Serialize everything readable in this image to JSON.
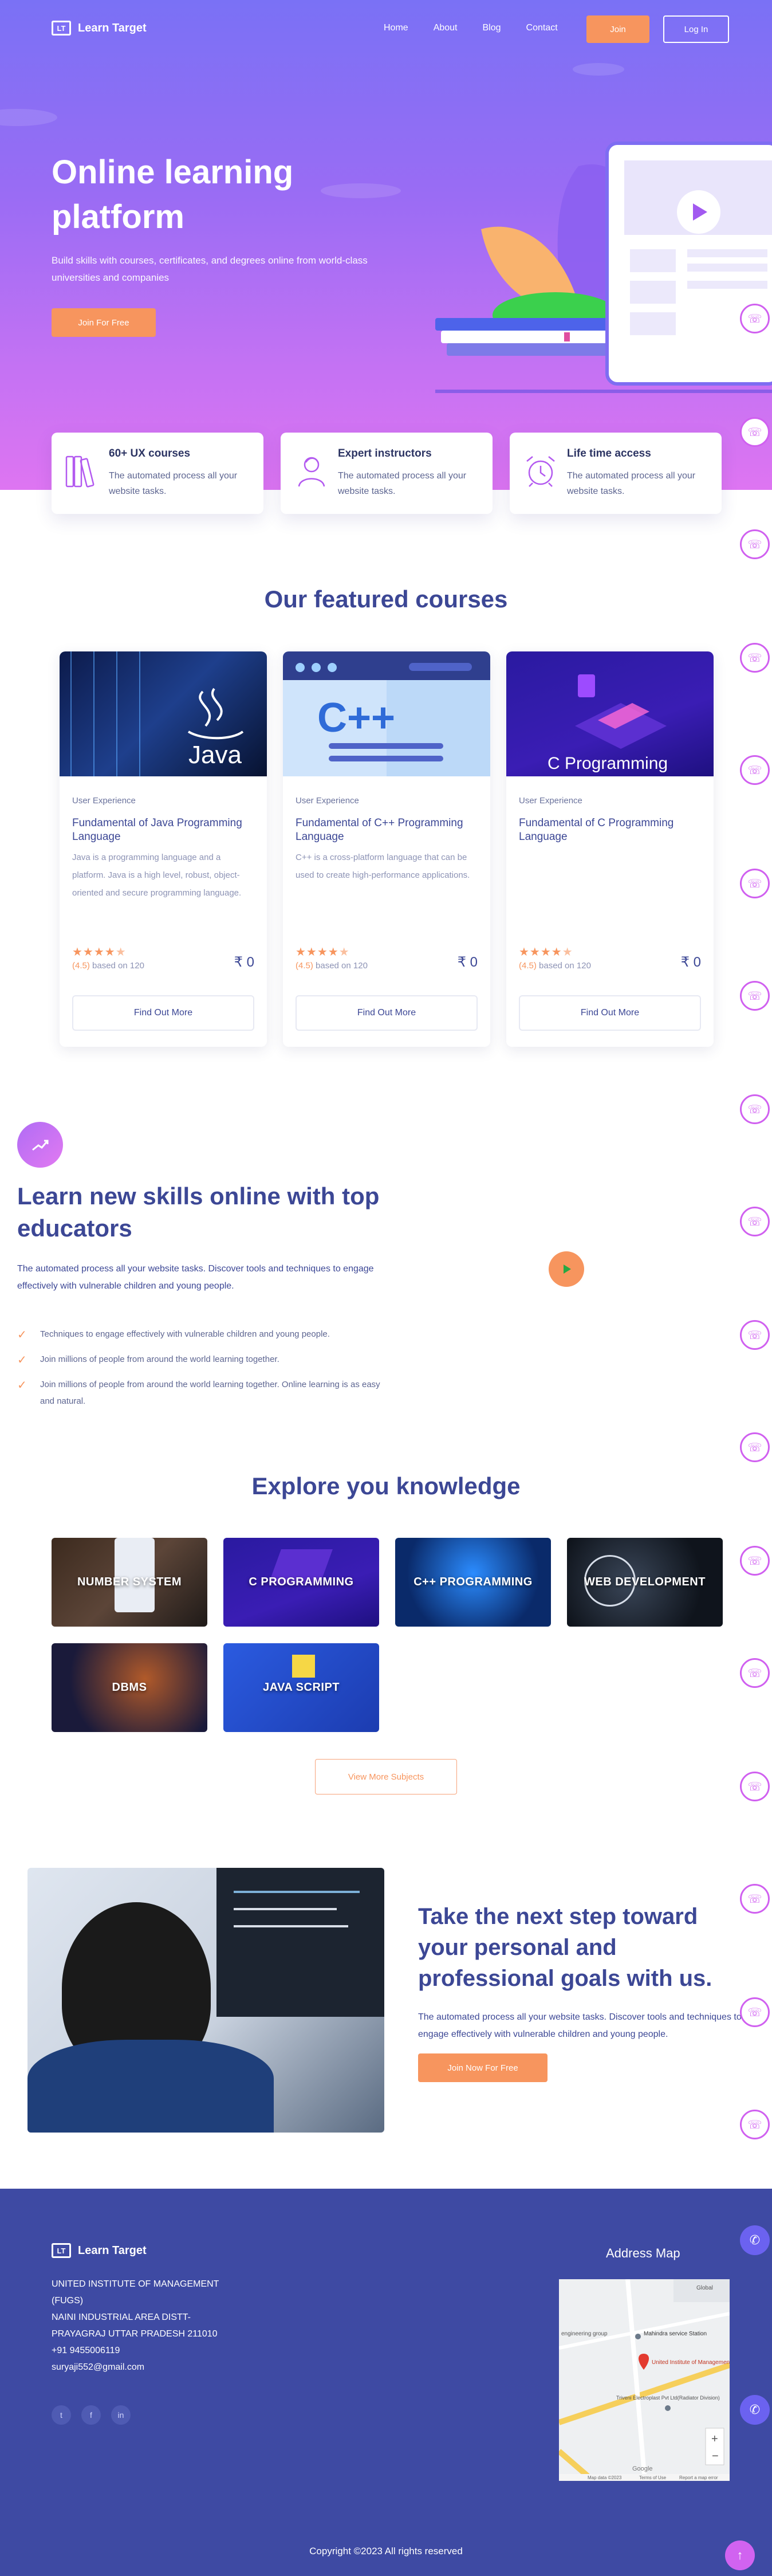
{
  "colors": {
    "accent": "#f7955e",
    "primary": "#3c4795",
    "footer": "#3e4aa3",
    "hero_start": "#7a71f5",
    "hero_end": "#de75f2"
  },
  "nav": {
    "logo_text": "Learn Target",
    "logo_mark": "LT",
    "links": [
      "Home",
      "About",
      "Blog",
      "Contact"
    ],
    "join_label": "Join",
    "login_label": "Log In"
  },
  "hero": {
    "title": "Online learning platform",
    "subtitle": "Build skills with courses, certificates, and degrees online from world-class universities and companies",
    "cta_label": "Join For Free"
  },
  "features": [
    {
      "icon": "books-icon",
      "title": "60+ UX courses",
      "desc": "The automated process all your website tasks."
    },
    {
      "icon": "instructor-icon",
      "title": "Expert instructors",
      "desc": "The automated process all your website tasks."
    },
    {
      "icon": "alarm-clock-icon",
      "title": "Life time access",
      "desc": "The automated process all your website tasks."
    }
  ],
  "featured": {
    "title": "Our featured courses",
    "courses": [
      {
        "image_label": "Java",
        "category": "User Experience",
        "name": "Fundamental of Java Programming Language",
        "desc": "Java is a programming language and a platform. Java is a high level, robust, object-oriented and secure programming language.",
        "rating": 4.5,
        "rating_value": "(4.5)",
        "based_on": "based on 120",
        "price": "₹ 0",
        "button": "Find Out More"
      },
      {
        "image_label": "C++",
        "category": "User Experience",
        "name": "Fundamental of C++ Programming Language",
        "desc": "C++ is a cross-platform language that can be used to create high-performance applications.",
        "rating": 4.5,
        "rating_value": "(4.5)",
        "based_on": "based on 120",
        "price": "₹ 0",
        "button": "Find Out More"
      },
      {
        "image_label": "C Programming",
        "category": "User Experience",
        "name": "Fundamental of C Programming Language",
        "desc": "",
        "rating": 4.5,
        "rating_value": "(4.5)",
        "based_on": "based on 120",
        "price": "₹ 0",
        "button": "Find Out More"
      }
    ]
  },
  "learn": {
    "title": "Learn new skills online with top educators",
    "desc": "The automated process all your website tasks. Discover tools and techniques to engage effectively with vulnerable children and young people.",
    "items": [
      "Techniques to engage effectively with vulnerable children and young people.",
      "Join millions of people from around the world learning together.",
      "Join millions of people from around the world learning together. Online learning is as easy and natural."
    ]
  },
  "explore": {
    "title": "Explore you knowledge",
    "tiles": [
      "NUMBER SYSTEM",
      "C PROGRAMMING",
      "C++ PROGRAMMING",
      "WEB DEVELOPMENT",
      "DBMS",
      "JAVA SCRIPT"
    ],
    "more_label": "View More Subjects"
  },
  "next_step": {
    "title": "Take the next step toward your personal and professional goals with us.",
    "desc": "The automated process all your website tasks. Discover tools and techniques to engage effectively with vulnerable children and young people.",
    "cta_label": "Join Now For Free"
  },
  "footer": {
    "logo_text": "Learn Target",
    "address_lines": [
      "UNITED INSTITUTE OF MANAGEMENT (FUGS)",
      "NAINI INDUSTRIAL AREA DISTT-PRAYAGRAJ UTTAR PRADESH 211010",
      "+91 9455006119",
      "suryaji552@gmail.com"
    ],
    "social": [
      "twitter-icon",
      "facebook-icon",
      "linkedin-icon"
    ],
    "map_title": "Address Map",
    "map_labels": [
      "Mahindra service Station",
      "United Institute of Management...",
      "Triveni Electroplast Pvt Ltd(Radiator Division)",
      "Global",
      "engineering group",
      "Google"
    ],
    "map_footer": [
      "Map data ©2023",
      "Terms of Use",
      "Report a map error"
    ],
    "copyright": "Copyright ©2023 All rights reserved"
  }
}
